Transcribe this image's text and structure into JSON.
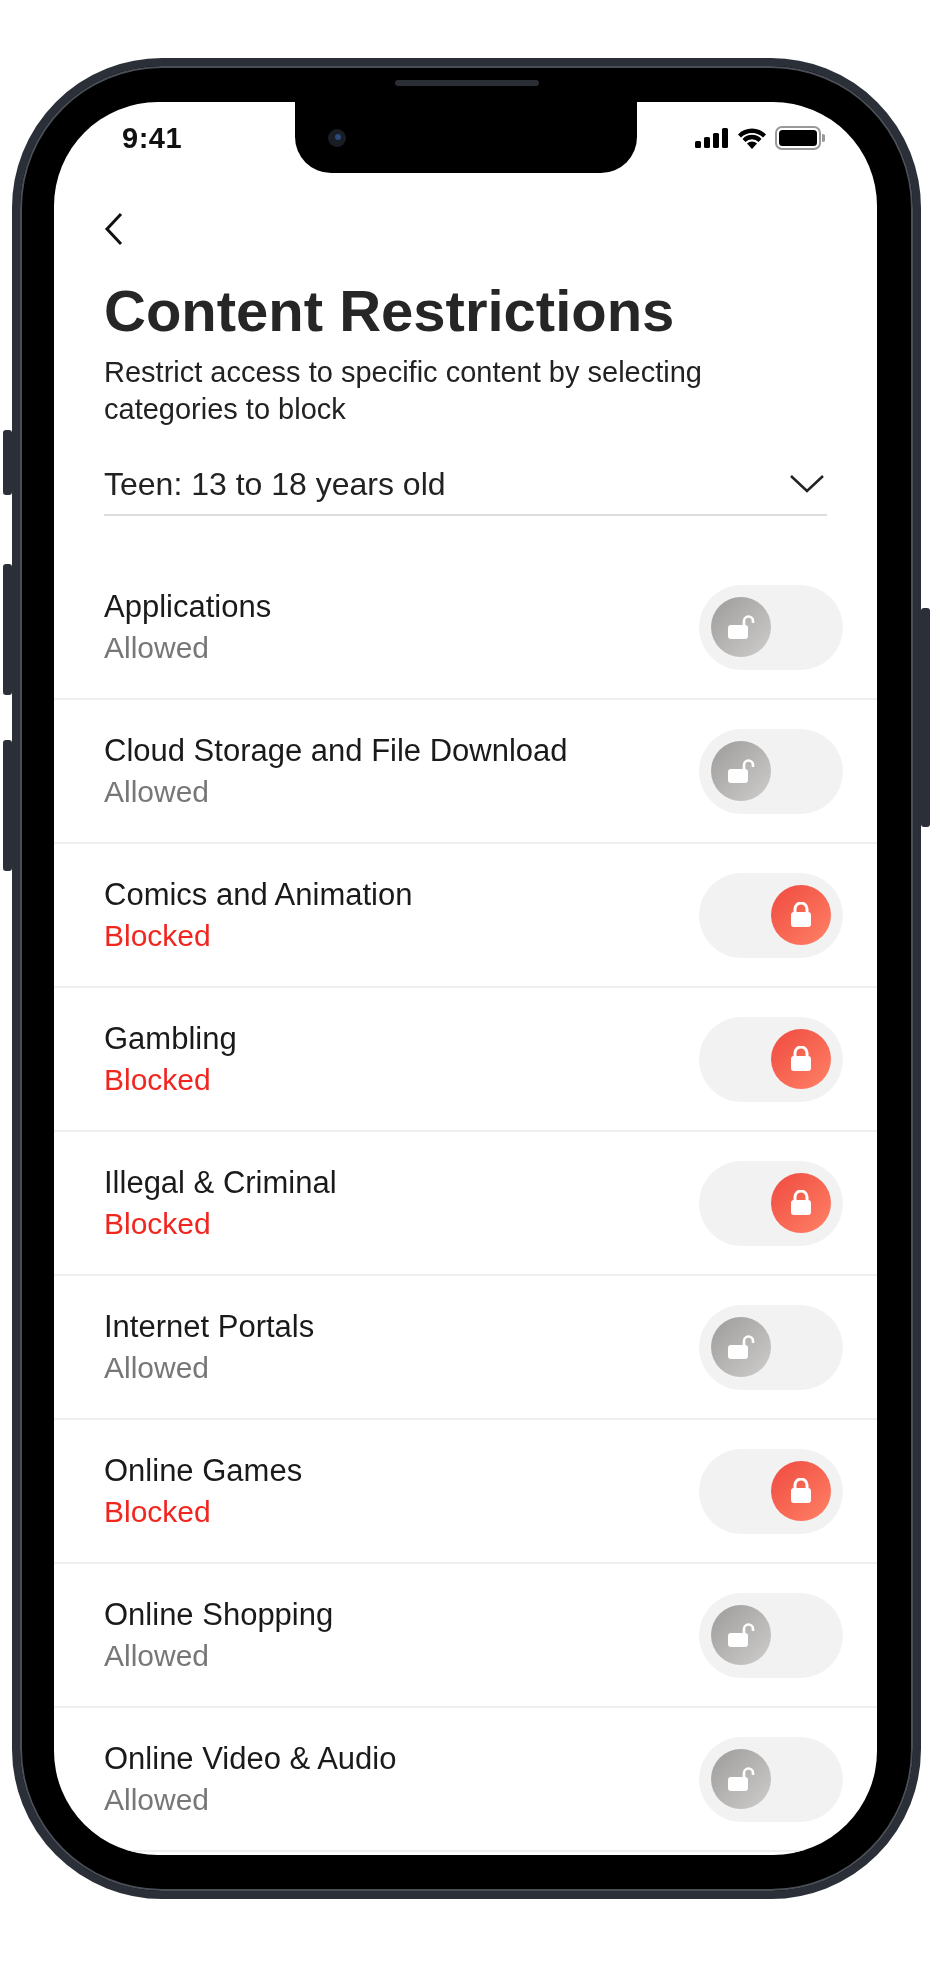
{
  "status_bar": {
    "time": "9:41"
  },
  "header": {
    "title": "Content Restrictions",
    "subtitle": "Restrict access to specific content by selecting categories to block"
  },
  "age_dropdown": {
    "value": "Teen: 13 to 18 years old"
  },
  "categories": [
    {
      "name": "Applications",
      "status": "Allowed",
      "blocked": false
    },
    {
      "name": "Cloud Storage and File Download",
      "status": "Allowed",
      "blocked": false
    },
    {
      "name": "Comics and Animation",
      "status": "Blocked",
      "blocked": true
    },
    {
      "name": "Gambling",
      "status": "Blocked",
      "blocked": true
    },
    {
      "name": "Illegal & Criminal",
      "status": "Blocked",
      "blocked": true
    },
    {
      "name": "Internet Portals",
      "status": "Allowed",
      "blocked": false
    },
    {
      "name": "Online Games",
      "status": "Blocked",
      "blocked": true
    },
    {
      "name": "Online Shopping",
      "status": "Allowed",
      "blocked": false
    },
    {
      "name": "Online Video & Audio",
      "status": "Allowed",
      "blocked": false
    }
  ]
}
